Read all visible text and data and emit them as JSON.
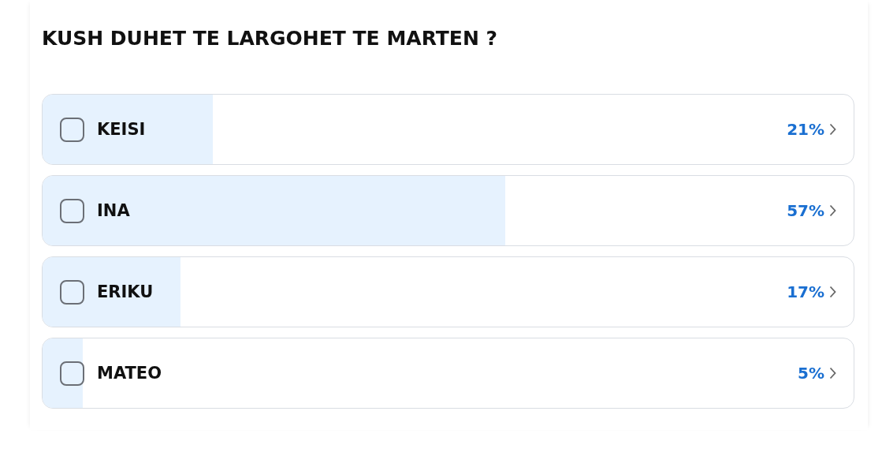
{
  "poll": {
    "question": "KUSH DUHET TE LARGOHET TE MARTEN ?",
    "options": [
      {
        "label": "KEISI",
        "percent": "21%",
        "level": 0.21,
        "checked": false
      },
      {
        "label": "INA",
        "percent": "57%",
        "level": 0.57,
        "checked": false
      },
      {
        "label": "ERIKU",
        "percent": "17%",
        "level": 0.17,
        "checked": false
      },
      {
        "label": "MATEO",
        "percent": "5%",
        "level": 0.05,
        "checked": false
      }
    ]
  }
}
